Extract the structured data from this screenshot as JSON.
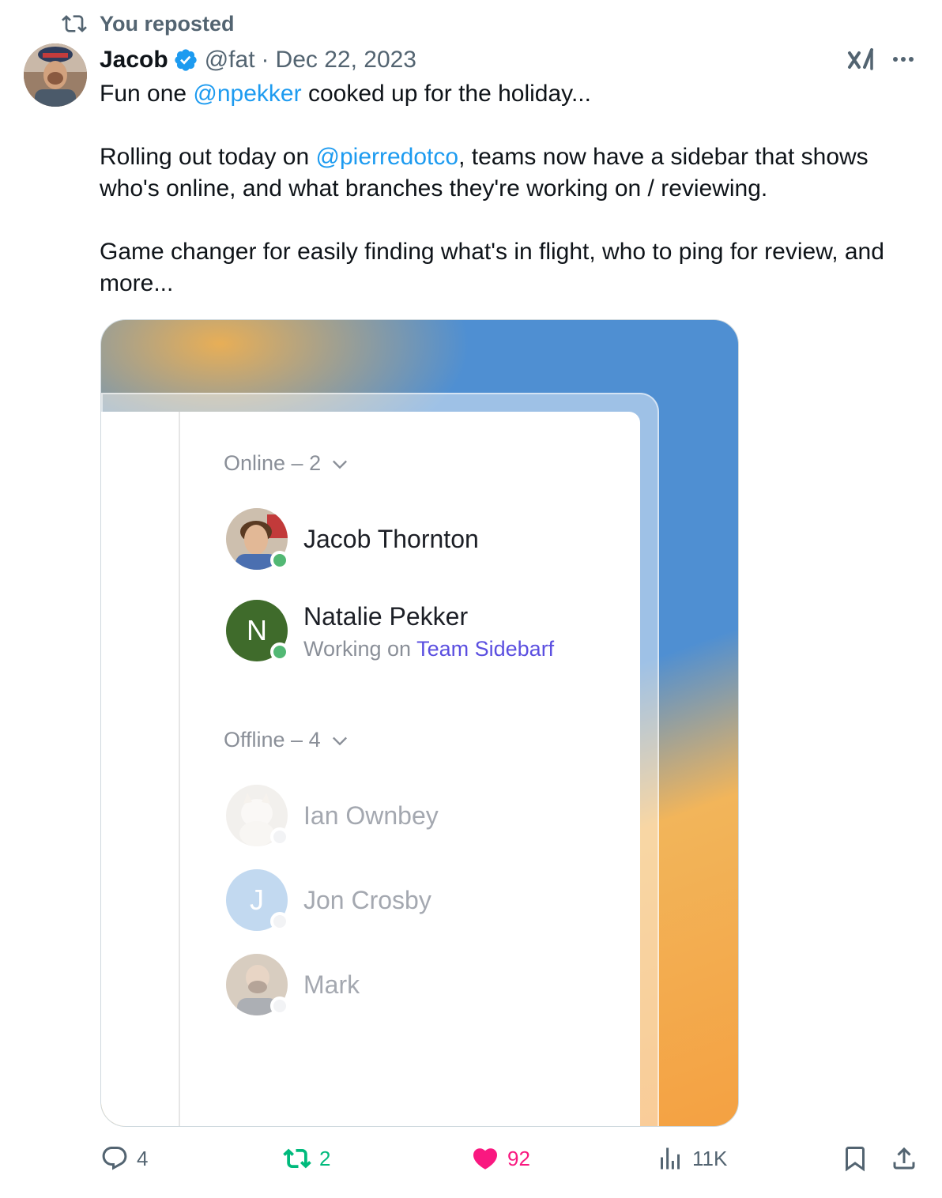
{
  "repost_banner": {
    "text": "You reposted"
  },
  "tweet": {
    "author_name": "Jacob",
    "handle": "@fat",
    "separator": "·",
    "date": "Dec 22, 2023",
    "text": {
      "line1_pre": "Fun one ",
      "line1_mention": "@npekker",
      "line1_post": " cooked up for the holiday...",
      "para2_pre": "Rolling out today on ",
      "para2_mention": "@pierredotco",
      "para2_post": ", teams now have a sidebar that shows who's online, and what branches they're working on / reviewing.",
      "para3": "Game changer for easily finding what's in flight, who to ping for review, and more..."
    }
  },
  "media": {
    "online_header": "Online – 2",
    "offline_header": "Offline – 4",
    "online": [
      {
        "name": "Jacob Thornton"
      },
      {
        "name": "Natalie Pekker",
        "initial": "N",
        "status_prefix": "Working on ",
        "branch": "Team Sidebarf"
      }
    ],
    "offline": [
      {
        "name": "Ian Ownbey"
      },
      {
        "name": "Jon Crosby",
        "initial": "J"
      },
      {
        "name": "Mark"
      }
    ],
    "colors": {
      "online_dot": "#52b874",
      "branch_link": "#5b4fe0",
      "natalie_avatar": "#3f6b2b",
      "jon_avatar": "#a9c9ea"
    }
  },
  "actions": {
    "replies": "4",
    "reposts": "2",
    "likes": "92",
    "views": "11K"
  },
  "icons": [
    "repost-icon",
    "verified-icon",
    "grok-icon",
    "more-icon",
    "chevron-down-icon",
    "reply-icon",
    "heart-icon",
    "views-icon",
    "bookmark-icon",
    "share-icon"
  ],
  "theme": {
    "link": "#1d9bf0",
    "muted": "#536471",
    "repost_green": "#00ba7c",
    "like_pink": "#f91880"
  }
}
